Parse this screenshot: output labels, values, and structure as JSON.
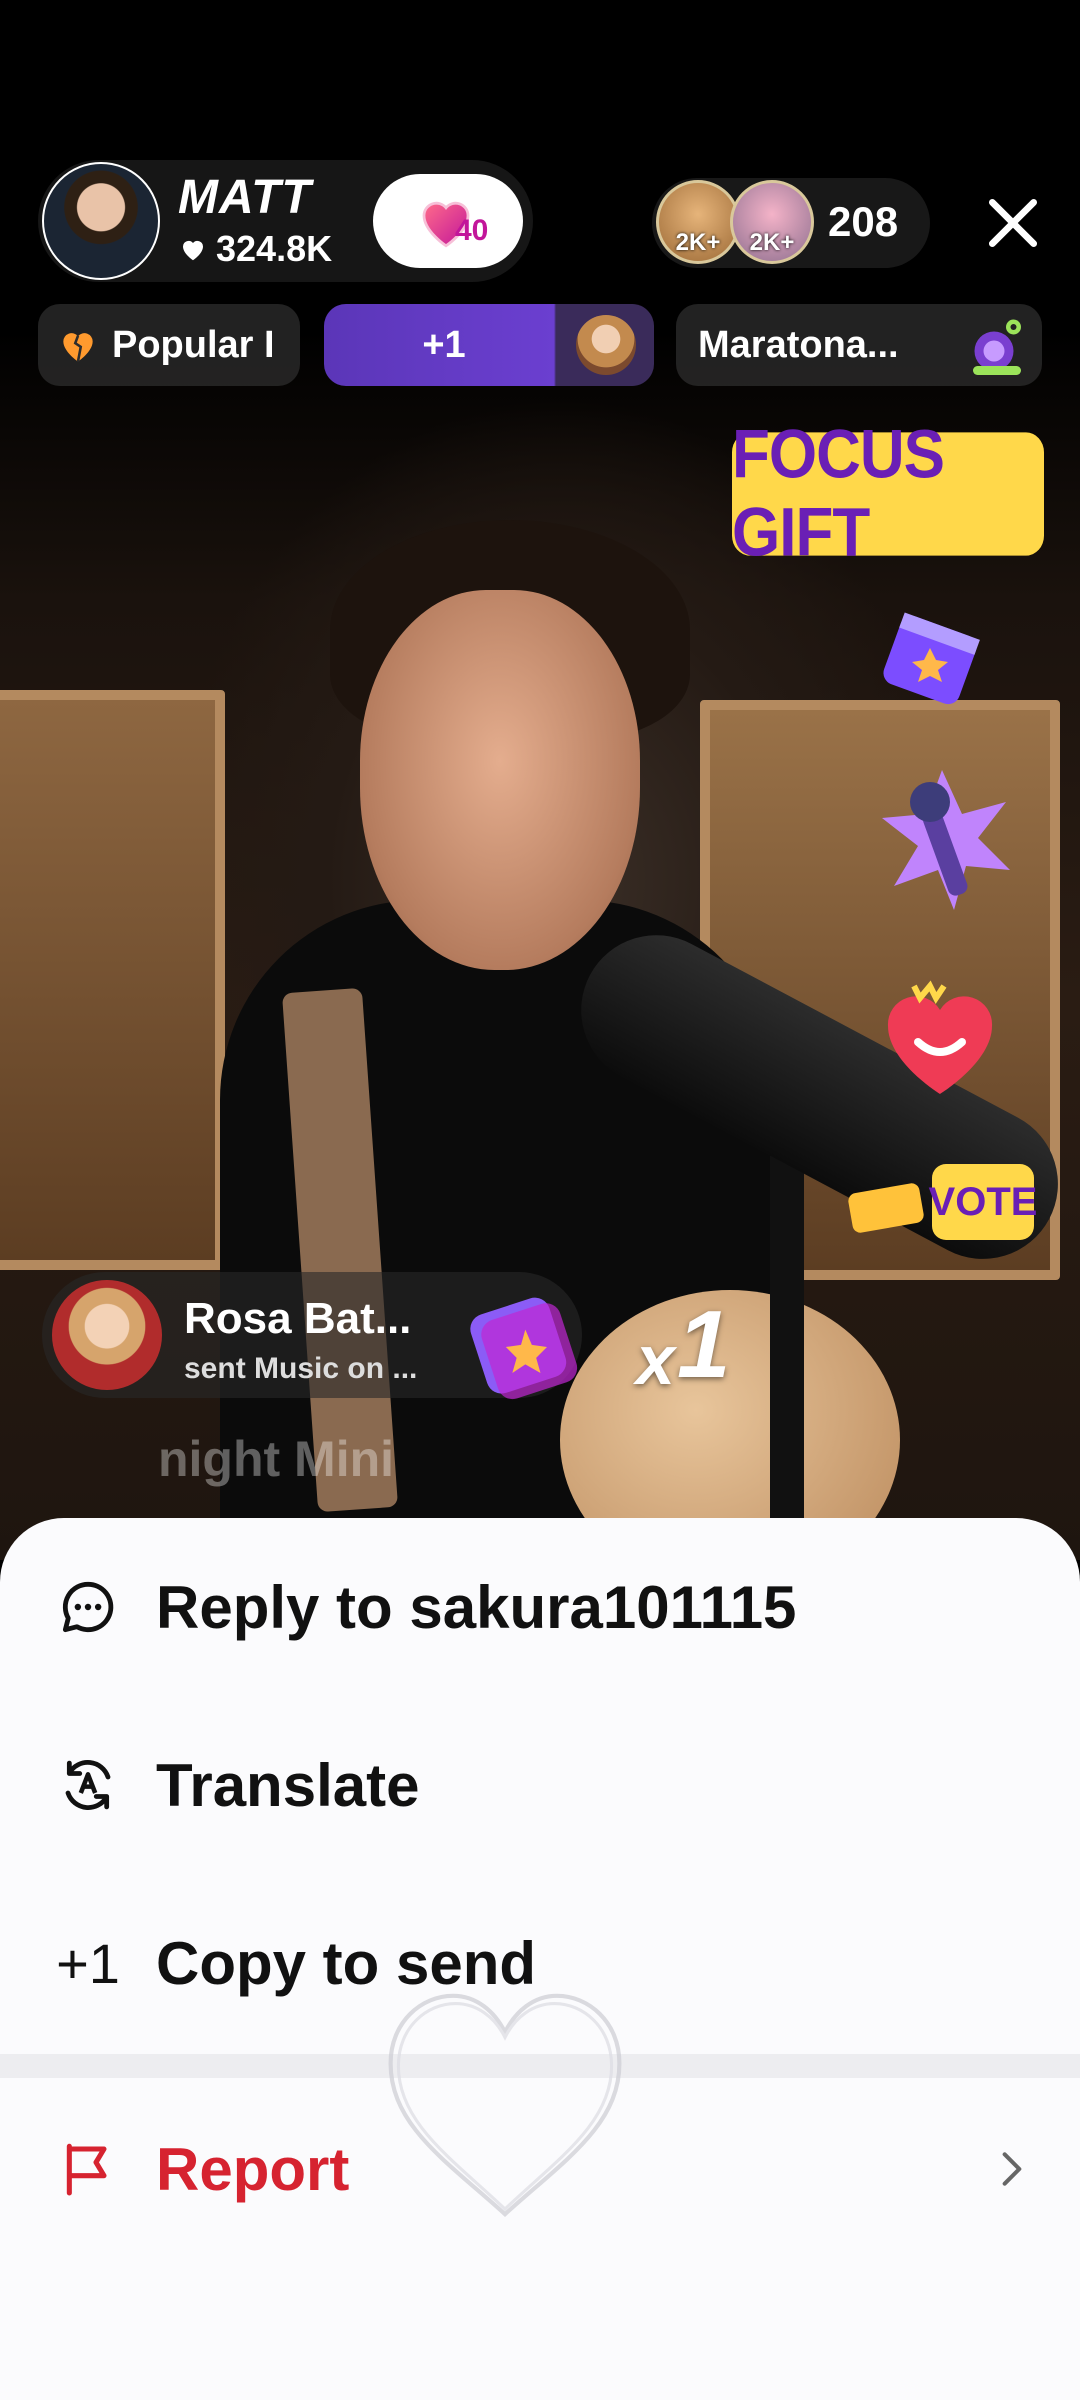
{
  "host": {
    "name": "MATT",
    "likes": "324.8K",
    "fan_level": "40"
  },
  "viewers": {
    "top1_label": "2K+",
    "top2_label": "2K+",
    "count": "208"
  },
  "chips": {
    "popular": "Popular I",
    "vote_plus": "+1",
    "marathon": "Maratona..."
  },
  "overlays": {
    "focus_gift": "FOCUS GIFT",
    "vote": "VOTE"
  },
  "gift_notice": {
    "sender": "Rosa Bat...",
    "message": "sent Music on ...",
    "count_prefix": "x",
    "count": "1"
  },
  "faded_comment": "night Mini",
  "menu": {
    "reply": "Reply to sakura101115",
    "translate": "Translate",
    "copy_icon": "+1",
    "copy": "Copy to send",
    "report": "Report"
  },
  "colors": {
    "report_red": "#d62330",
    "accent_purple": "#6a1fb5",
    "badge_yellow": "#ffd84a"
  },
  "icons": {
    "reply": "chat-bubble-icon",
    "translate": "translate-icon",
    "report": "flag-icon",
    "close": "close-icon",
    "chevron": "chevron-right-icon"
  }
}
